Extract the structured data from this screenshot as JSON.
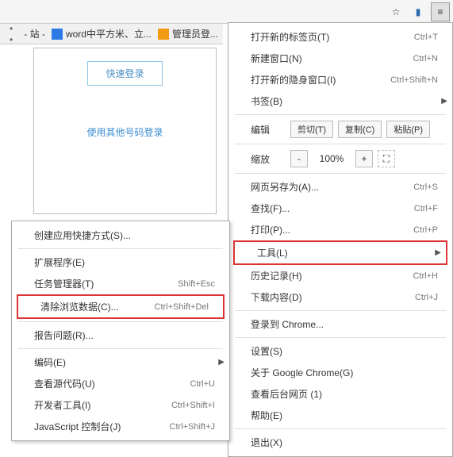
{
  "toolbar": {
    "star": "☆",
    "bookmark": "▮",
    "menu": "≡"
  },
  "tabs": {
    "t1": "- 站 -",
    "t2": "word中平方米、立...",
    "t3": "管理员登..."
  },
  "content": {
    "quick_login": "快速登录",
    "alt_login": "使用其他号码登录"
  },
  "menu": {
    "new_tab": "打开新的标签页(T)",
    "new_tab_sc": "Ctrl+T",
    "new_win": "新建窗口(N)",
    "new_win_sc": "Ctrl+N",
    "incognito": "打开新的隐身窗口(I)",
    "incognito_sc": "Ctrl+Shift+N",
    "bookmarks": "书签(B)",
    "edit_lbl": "编辑",
    "cut": "剪切(T)",
    "copy": "复制(C)",
    "paste": "粘贴(P)",
    "zoom_lbl": "缩放",
    "zoom_val": "100%",
    "saveas": "网页另存为(A)...",
    "saveas_sc": "Ctrl+S",
    "find": "查找(F)...",
    "find_sc": "Ctrl+F",
    "print": "打印(P)...",
    "print_sc": "Ctrl+P",
    "tools": "工具(L)",
    "history": "历史记录(H)",
    "history_sc": "Ctrl+H",
    "downloads": "下载内容(D)",
    "downloads_sc": "Ctrl+J",
    "signin": "登录到 Chrome...",
    "settings": "设置(S)",
    "about": "关于 Google Chrome(G)",
    "bgpages": "查看后台网页 (1)",
    "help": "帮助(E)",
    "exit": "退出(X)"
  },
  "submenu": {
    "create_shortcut": "创建应用快捷方式(S)...",
    "extensions": "扩展程序(E)",
    "taskmgr": "任务管理器(T)",
    "taskmgr_sc": "Shift+Esc",
    "clear": "清除浏览数据(C)...",
    "clear_sc": "Ctrl+Shift+Del",
    "report": "报告问题(R)...",
    "encoding": "编码(E)",
    "viewsrc": "查看源代码(U)",
    "viewsrc_sc": "Ctrl+U",
    "devtools": "开发者工具(I)",
    "devtools_sc": "Ctrl+Shift+I",
    "jsconsole": "JavaScript 控制台(J)",
    "jsconsole_sc": "Ctrl+Shift+J"
  }
}
